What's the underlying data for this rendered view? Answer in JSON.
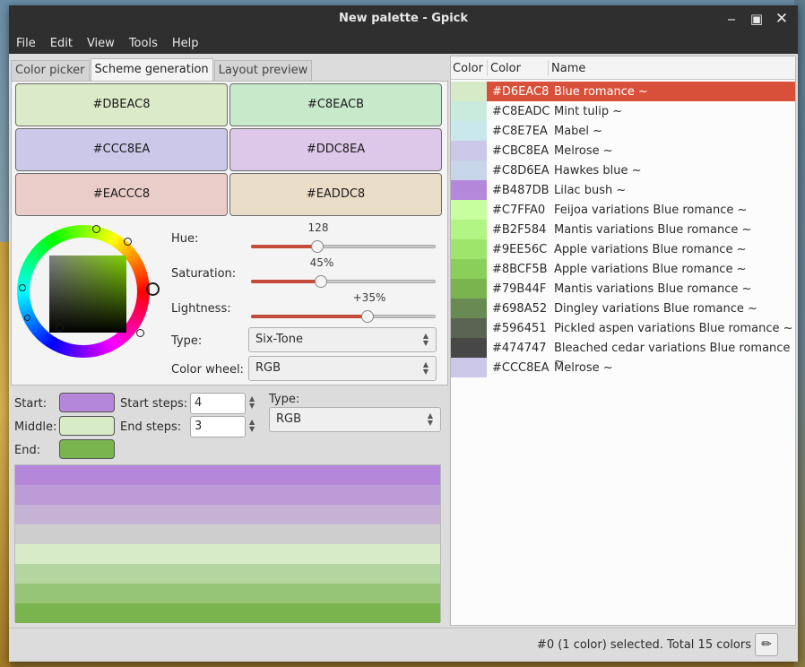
{
  "window": {
    "title": "New palette - Gpick"
  },
  "menu": [
    "File",
    "Edit",
    "View",
    "Tools",
    "Help"
  ],
  "tabs": [
    "Color picker",
    "Scheme generation",
    "Layout preview"
  ],
  "swatches": [
    {
      "label": "#DBEAC8",
      "color": "#DBEAC8"
    },
    {
      "label": "#C8EACB",
      "color": "#C8EACB"
    },
    {
      "label": "#CCC8EA",
      "color": "#CCC8EA"
    },
    {
      "label": "#DDC8EA",
      "color": "#DDC8EA"
    },
    {
      "label": "#EACCC8",
      "color": "#EACCC8"
    },
    {
      "label": "#EADDC8",
      "color": "#EADDC8"
    }
  ],
  "controls": {
    "hue_label": "Hue:",
    "hue_value": "128",
    "hue_fraction": 0.36,
    "saturation_label": "Saturation:",
    "saturation_value": "45%",
    "saturation_fraction": 0.38,
    "lightness_label": "Lightness:",
    "lightness_value": "+35%",
    "lightness_fraction": 0.63,
    "type_label": "Type:",
    "type_value": "Six-Tone",
    "wheel_label": "Color wheel:",
    "wheel_value": "RGB"
  },
  "gradient": {
    "start_label": "Start:",
    "start_color": "#B487DB",
    "middle_label": "Middle:",
    "middle_color": "#D8EBC8",
    "end_label": "End:",
    "end_color": "#79B44F",
    "start_steps_label": "Start steps:",
    "start_steps": "4",
    "end_steps_label": "End steps:",
    "end_steps": "3",
    "type_label": "Type:",
    "type_value": "RGB",
    "bands": [
      "#B487DB",
      "#BC9BD7",
      "#C5B2D4",
      "#CECECE",
      "#D8EBC8",
      "#B3D59F",
      "#96C577",
      "#79B44F"
    ]
  },
  "list": {
    "headers": [
      "Color",
      "Color",
      "Name"
    ],
    "rows": [
      {
        "hex": "#D6EAC8",
        "name": "Blue romance ~",
        "color": "#D6EAC8",
        "selected": true
      },
      {
        "hex": "#C8EADC",
        "name": "Mint tulip ~",
        "color": "#C8EADC"
      },
      {
        "hex": "#C8E7EA",
        "name": "Mabel ~",
        "color": "#C8E7EA"
      },
      {
        "hex": "#CBC8EA",
        "name": "Melrose ~",
        "color": "#CBC8EA"
      },
      {
        "hex": "#C8D6EA",
        "name": "Hawkes blue ~",
        "color": "#C8D6EA"
      },
      {
        "hex": "#B487DB",
        "name": "Lilac bush ~",
        "color": "#B487DB"
      },
      {
        "hex": "#C7FFA0",
        "name": "Feijoa variations Blue romance ~",
        "color": "#C7FFA0"
      },
      {
        "hex": "#B2F584",
        "name": "Mantis variations Blue romance ~",
        "color": "#B2F584"
      },
      {
        "hex": "#9EE56C",
        "name": "Apple variations Blue romance ~",
        "color": "#9EE56C"
      },
      {
        "hex": "#8BCF5B",
        "name": "Apple variations Blue romance ~",
        "color": "#8BCF5B"
      },
      {
        "hex": "#79B44F",
        "name": "Mantis variations Blue romance ~",
        "color": "#79B44F"
      },
      {
        "hex": "#698A52",
        "name": "Dingley variations Blue romance ~",
        "color": "#698A52"
      },
      {
        "hex": "#596451",
        "name": "Pickled aspen variations Blue romance ~",
        "color": "#596451"
      },
      {
        "hex": "#474747",
        "name": "Bleached cedar variations Blue romance ~",
        "color": "#474747"
      },
      {
        "hex": "#CCC8EA",
        "name": "Melrose ~",
        "color": "#CCC8EA"
      }
    ]
  },
  "status": {
    "text": "#0 (1 color) selected. Total 15 colors"
  },
  "icons": [
    "minimize-icon",
    "maximize-icon",
    "close-icon",
    "color-dropper-icon"
  ]
}
